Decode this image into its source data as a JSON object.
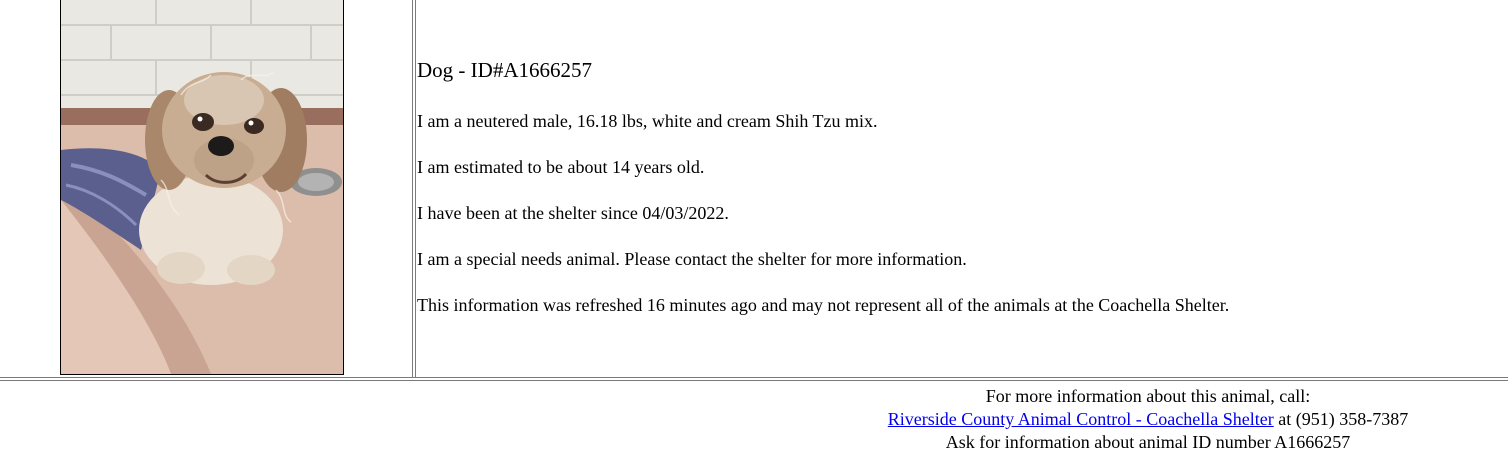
{
  "animal": {
    "heading": "Dog - ID#A1666257",
    "description": "I am a neutered male, 16.18 lbs, white and cream Shih Tzu mix.",
    "age": "I am estimated to be about 14 years old.",
    "since": "I have been at the shelter since 04/03/2022.",
    "special_needs": "I am a special needs animal. Please contact the shelter for more information.",
    "refresh_note": "This information was refreshed 16 minutes ago and may not represent all of the animals at the Coachella Shelter."
  },
  "contact": {
    "intro": "For more information about this animal, call:",
    "shelter_link": "Riverside County Animal Control - Coachella Shelter",
    "phone": " at (951) 358-7387",
    "ask": "Ask for information about animal ID number A1666257"
  },
  "colors": {
    "link": "#0000ee",
    "wall": "#e8e6df",
    "floor": "#d8b8a4",
    "blanket": "#5a5f8c"
  }
}
